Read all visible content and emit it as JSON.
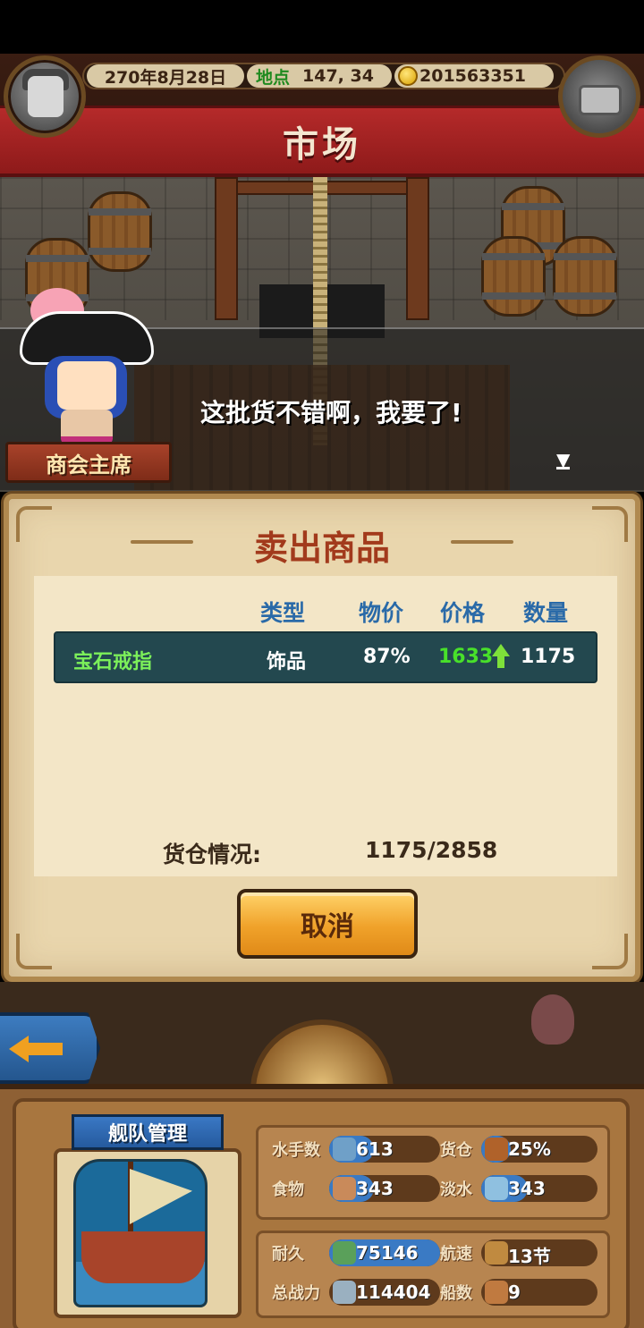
{
  "hud": {
    "date": "270年8月28日",
    "location_label": "地点",
    "location_value": "147, 34",
    "gold": "201563351"
  },
  "header": {
    "title": "市场"
  },
  "dialog": {
    "speaker": "商会主席",
    "text": "这批货不错啊，我要了!",
    "next_icon": "down-arrow-icon"
  },
  "sell_panel": {
    "title": "卖出商品",
    "columns": [
      "类型",
      "物价",
      "价格",
      "数量"
    ],
    "rows": [
      {
        "name": "宝石戒指",
        "type": "饰品",
        "index": "87%",
        "price": "1633",
        "price_trend": "up",
        "quantity": "1175"
      }
    ],
    "cargo_label": "货仓情况:",
    "cargo_value": "1175/2858",
    "cancel_label": "取消"
  },
  "fleet": {
    "title": "舰队管理",
    "stats": [
      {
        "label": "水手数",
        "value": "613",
        "icon": "sailor-icon"
      },
      {
        "label": "货仓",
        "value": "25%",
        "icon": "cargo-icon"
      },
      {
        "label": "食物",
        "value": "343",
        "icon": "food-icon"
      },
      {
        "label": "淡水",
        "value": "343",
        "icon": "water-icon"
      },
      {
        "label": "耐久",
        "value": "75146",
        "icon": "durability-icon"
      },
      {
        "label": "航速",
        "value": "13节",
        "icon": "speed-icon"
      },
      {
        "label": "总战力",
        "value": "114404",
        "icon": "power-icon"
      },
      {
        "label": "船数",
        "value": "9",
        "icon": "ship-count-icon"
      }
    ],
    "levels": {
      "sailors": 0.4,
      "cargo": 0.25,
      "food": 0.4,
      "water": 0.4,
      "durability": 1.0
    }
  },
  "colors": {
    "banner_red": "#b52a2a",
    "row_teal": "#23484f",
    "price_green": "#48e02a",
    "button_orange": "#f0a22a"
  }
}
